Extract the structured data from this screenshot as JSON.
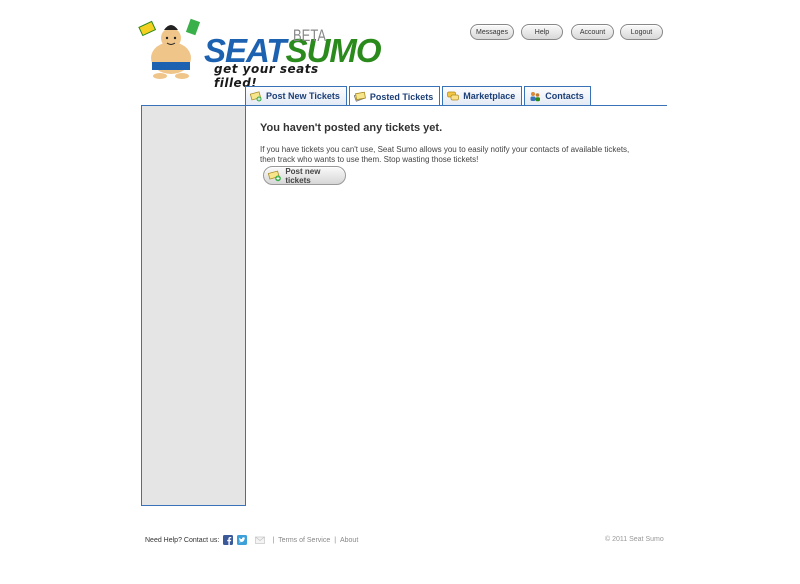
{
  "brand": {
    "name_part1": "SEAT",
    "name_part2": "SUMO",
    "badge": "BETA",
    "tagline": "get your seats filled!"
  },
  "top_nav": {
    "messages": "Messages",
    "help": "Help",
    "account": "Account",
    "logout": "Logout"
  },
  "tabs": [
    {
      "label": "Post New Tickets",
      "icon": "ticket-add-icon",
      "active": false
    },
    {
      "label": "Posted Tickets",
      "icon": "tickets-icon",
      "active": true
    },
    {
      "label": "Marketplace",
      "icon": "speech-bubbles-icon",
      "active": false
    },
    {
      "label": "Contacts",
      "icon": "people-icon",
      "active": false
    }
  ],
  "main": {
    "heading": "You haven't posted any tickets yet.",
    "body": "If you have tickets you can't use, Seat Sumo allows you to easily notify your contacts of available tickets, then track who wants to use them. Stop wasting those tickets!",
    "button_label": "Post new tickets"
  },
  "footer": {
    "help_text": "Need Help? Contact us:",
    "separator": "|",
    "terms": "Terms of Service",
    "about": "About",
    "copyright": "© 2011 Seat Sumo"
  },
  "colors": {
    "accent_blue": "#3a72b8",
    "brand_blue": "#1d62b1",
    "brand_green": "#2a8a1c",
    "sidebar_bg": "#e5e5e5"
  }
}
